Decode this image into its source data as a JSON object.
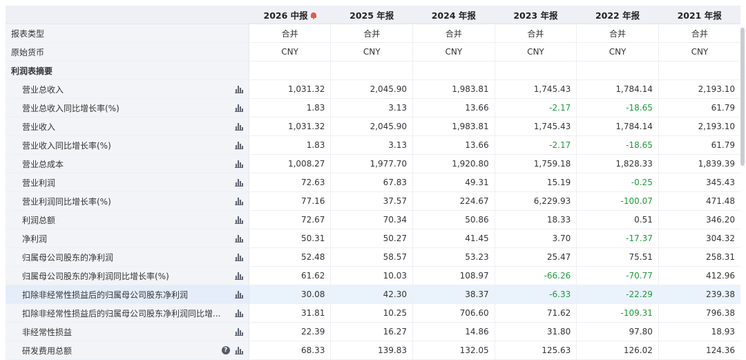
{
  "header": {
    "years": [
      "2026 中报",
      "2025 年报",
      "2024 年报",
      "2023 年报",
      "2022 年报",
      "2021 年报"
    ]
  },
  "colors": {
    "negative": "#1f9a3a",
    "header_bg": "#eef0f6",
    "highlight_row": "#eaf2fc"
  },
  "meta_rows": [
    {
      "label": "报表类型",
      "values": [
        "合并",
        "合并",
        "合并",
        "合并",
        "合并",
        "合并"
      ]
    },
    {
      "label": "原始货币",
      "values": [
        "CNY",
        "CNY",
        "CNY",
        "CNY",
        "CNY",
        "CNY"
      ]
    }
  ],
  "section": {
    "label": "利润表摘要"
  },
  "rows": [
    {
      "label": "营业总收入",
      "values": [
        "1,031.32",
        "2,045.90",
        "1,983.81",
        "1,745.43",
        "1,784.14",
        "2,193.10"
      ]
    },
    {
      "label": "营业总收入同比增长率(%)",
      "values": [
        "1.83",
        "3.13",
        "13.66",
        "-2.17",
        "-18.65",
        "61.79"
      ]
    },
    {
      "label": "营业收入",
      "values": [
        "1,031.32",
        "2,045.90",
        "1,983.81",
        "1,745.43",
        "1,784.14",
        "2,193.10"
      ]
    },
    {
      "label": "营业收入同比增长率(%)",
      "values": [
        "1.83",
        "3.13",
        "13.66",
        "-2.17",
        "-18.65",
        "61.79"
      ]
    },
    {
      "label": "营业总成本",
      "values": [
        "1,008.27",
        "1,977.70",
        "1,920.80",
        "1,759.18",
        "1,828.33",
        "1,839.39"
      ]
    },
    {
      "label": "营业利润",
      "values": [
        "72.63",
        "67.83",
        "49.31",
        "15.19",
        "-0.25",
        "345.43"
      ]
    },
    {
      "label": "营业利润同比增长率(%)",
      "values": [
        "77.16",
        "37.57",
        "224.67",
        "6,229.93",
        "-100.07",
        "471.48"
      ]
    },
    {
      "label": "利润总额",
      "values": [
        "72.67",
        "70.34",
        "50.86",
        "18.33",
        "0.51",
        "346.20"
      ]
    },
    {
      "label": "净利润",
      "values": [
        "50.31",
        "50.27",
        "41.45",
        "3.70",
        "-17.37",
        "304.32"
      ]
    },
    {
      "label": "归属母公司股东的净利润",
      "values": [
        "52.48",
        "58.57",
        "53.23",
        "25.47",
        "75.51",
        "258.31"
      ]
    },
    {
      "label": "归属母公司股东的净利润同比增长率(%)",
      "values": [
        "61.62",
        "10.03",
        "108.97",
        "-66.26",
        "-70.77",
        "412.96"
      ]
    },
    {
      "label": "扣除非经常性损益后的归属母公司股东净利润",
      "values": [
        "30.08",
        "42.30",
        "38.37",
        "-6.33",
        "-22.29",
        "239.38"
      ],
      "highlight": true
    },
    {
      "label": "扣除非经常性损益后的归属母公司股东净利润同比增...",
      "values": [
        "31.81",
        "10.25",
        "706.60",
        "71.62",
        "-109.31",
        "796.38"
      ]
    },
    {
      "label": "非经常性损益",
      "values": [
        "22.39",
        "16.27",
        "14.86",
        "31.80",
        "97.80",
        "18.93"
      ]
    },
    {
      "label": "研发费用总额",
      "values": [
        "68.33",
        "139.83",
        "132.05",
        "125.63",
        "126.02",
        "124.36"
      ],
      "help": true
    }
  ]
}
